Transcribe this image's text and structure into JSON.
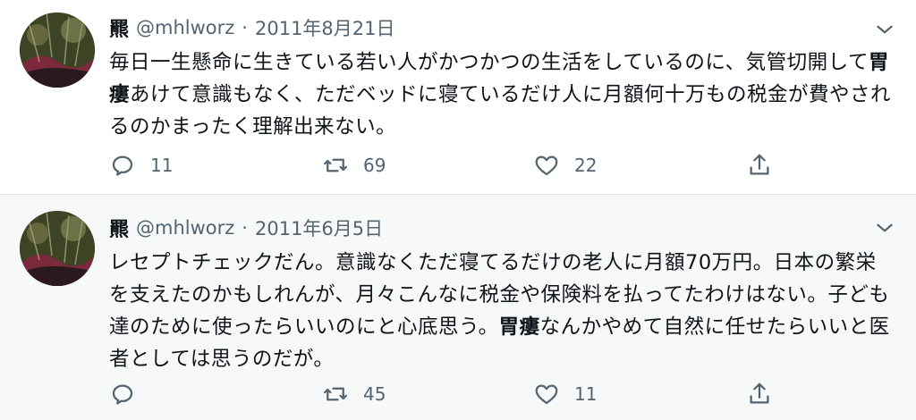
{
  "tweets": [
    {
      "author": {
        "name": "羆",
        "handle": "@mhlworz",
        "separator": "·",
        "date": "2011年8月21日",
        "avatar": "avatar-icon"
      },
      "text_parts": [
        "毎日一生懸命に生きている若い人がかつかつの生活をしているのに、気管切開して",
        "胃瘻",
        "あけて意識もなく、ただベッドに寝ているだけ人に月額何十万もの税金が費やされるのかまったく理解出来ない。"
      ],
      "actions": {
        "reply": {
          "icon": "reply-icon",
          "count": "11"
        },
        "retweet": {
          "icon": "retweet-icon",
          "count": "69"
        },
        "like": {
          "icon": "heart-icon",
          "count": "22"
        },
        "share": {
          "icon": "share-icon"
        }
      },
      "menu_icon": "chevron-down-icon"
    },
    {
      "author": {
        "name": "羆",
        "handle": "@mhlworz",
        "separator": "·",
        "date": "2011年6月5日",
        "avatar": "avatar-icon"
      },
      "text_parts": [
        "レセプトチェックだん。意識なくただ寝てるだけの老人に月額70万円。日本の繁栄を支えたのかもしれんが、月々こんなに税金や保険料を払ってたわけはない。子ども達のために使ったらいいのにと心底思う。",
        "胃瘻",
        "なんかやめて自然に任せたらいいと医者としては思うのだが。"
      ],
      "actions": {
        "reply": {
          "icon": "reply-icon",
          "count": ""
        },
        "retweet": {
          "icon": "retweet-icon",
          "count": "45"
        },
        "like": {
          "icon": "heart-icon",
          "count": "11"
        },
        "share": {
          "icon": "share-icon"
        }
      },
      "menu_icon": "chevron-down-icon"
    }
  ],
  "colors": {
    "text": "#0f1419",
    "secondary": "#536471",
    "divider": "#e1e8ed",
    "hover_bg": "#f7f9f9"
  }
}
